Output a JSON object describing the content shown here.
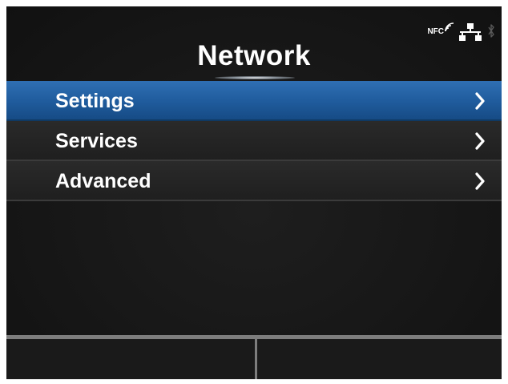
{
  "header": {
    "title": "Network"
  },
  "status": {
    "nfc_label": "NFC",
    "icons": [
      "nfc-icon",
      "network-icon",
      "bluetooth-icon"
    ]
  },
  "menu": {
    "items": [
      {
        "label": "Settings",
        "selected": true
      },
      {
        "label": "Services",
        "selected": false
      },
      {
        "label": "Advanced",
        "selected": false
      }
    ]
  },
  "colors": {
    "selected": "#1f5b9c",
    "background": "#171717",
    "text": "#ffffff"
  }
}
